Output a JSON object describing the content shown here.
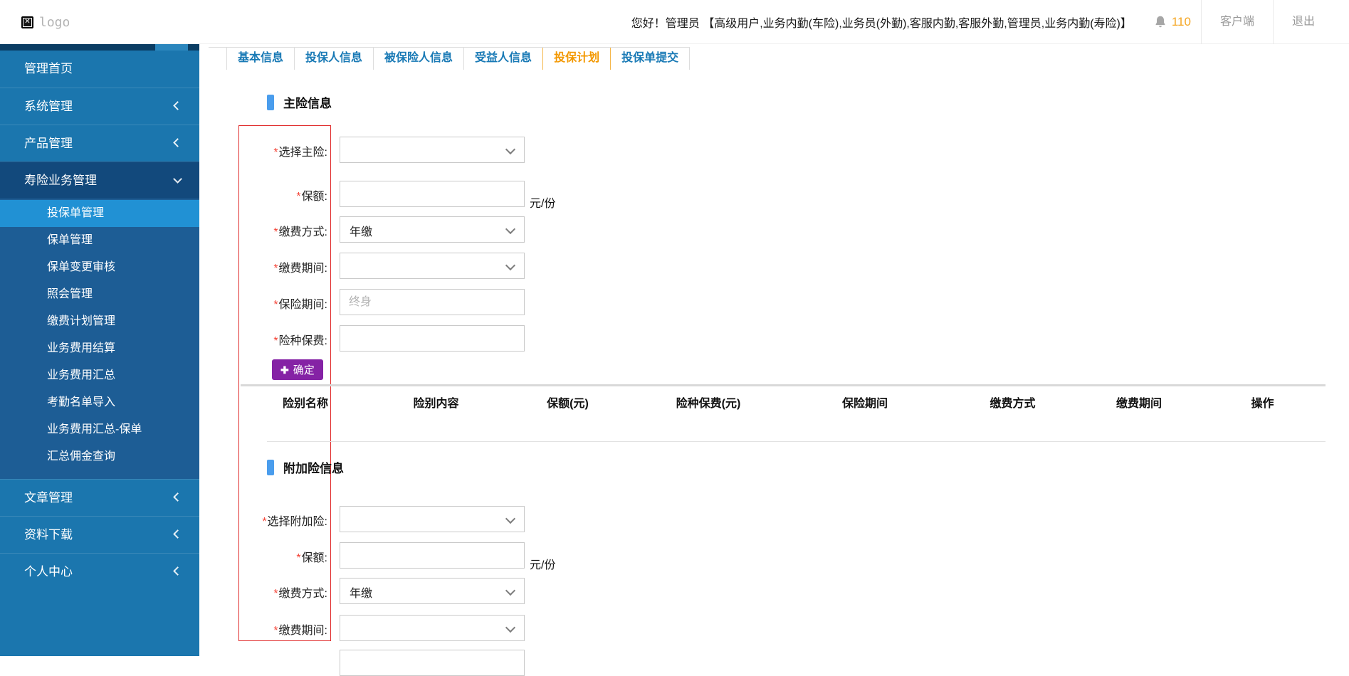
{
  "header": {
    "logo_text": "logo",
    "greeting": "您好！管理员 【高级用户,业务内勤(车险),业务员(外勤),客服内勤,客服外勤,管理员,业务内勤(寿险)】",
    "notification_count": "110",
    "client_label": "客户端",
    "logout_label": "退出"
  },
  "sidebar": {
    "items": [
      {
        "label": "管理首页"
      },
      {
        "label": "系统管理",
        "chevron": "left"
      },
      {
        "label": "产品管理",
        "chevron": "left"
      },
      {
        "label": "寿险业务管理",
        "chevron": "down",
        "expanded": true
      },
      {
        "label": "文章管理",
        "chevron": "left"
      },
      {
        "label": "资料下载",
        "chevron": "left"
      },
      {
        "label": "个人中心",
        "chevron": "left"
      }
    ],
    "submenu": [
      {
        "label": "投保单管理",
        "active": true
      },
      {
        "label": "保单管理"
      },
      {
        "label": "保单变更审核"
      },
      {
        "label": "照会管理"
      },
      {
        "label": "缴费计划管理"
      },
      {
        "label": "业务费用结算"
      },
      {
        "label": "业务费用汇总"
      },
      {
        "label": "考勤名单导入"
      },
      {
        "label": "业务费用汇总-保单"
      },
      {
        "label": "汇总佣金查询"
      }
    ]
  },
  "tabs": [
    {
      "label": "基本信息"
    },
    {
      "label": "投保人信息"
    },
    {
      "label": "被保险人信息"
    },
    {
      "label": "受益人信息"
    },
    {
      "label": "投保计划",
      "active": true
    },
    {
      "label": "投保单提交"
    }
  ],
  "form": {
    "required_mark": "*",
    "main_section": {
      "title": "主险信息",
      "fields": {
        "select_main": {
          "label": "选择主险:",
          "value": ""
        },
        "amount": {
          "label": "保额:",
          "value": "",
          "suffix": "元/份"
        },
        "pay_method": {
          "label": "缴费方式:",
          "value": "年缴"
        },
        "pay_period": {
          "label": "缴费期间:",
          "value": ""
        },
        "insure_period": {
          "label": "保险期间:",
          "value": "",
          "placeholder": "终身"
        },
        "premium": {
          "label": "险种保费:",
          "value": ""
        }
      },
      "confirm_button": "确定"
    },
    "additional_section": {
      "title": "附加险信息",
      "fields": {
        "select_additional": {
          "label": "选择附加险:",
          "value": ""
        },
        "amount": {
          "label": "保额:",
          "value": "",
          "suffix": "元/份"
        },
        "pay_method": {
          "label": "缴费方式:",
          "value": "年缴"
        },
        "pay_period": {
          "label": "缴费期间:",
          "value": ""
        }
      }
    }
  },
  "table": {
    "headers": [
      "险别名称",
      "险别内容",
      "保额(元)",
      "险种保费(元)",
      "保险期间",
      "缴费方式",
      "缴费期间",
      "操作"
    ]
  },
  "icons": {
    "logo": "broken-image",
    "notification": "bell",
    "confirm_plus": "✚",
    "broken_glyph": "✕"
  },
  "colors": {
    "sidebar_bg": "#1b76ae",
    "sidebar_group_bg": "#12497c",
    "submenu_bg": "#1d5d95",
    "submenu_active_bg": "#2191d4",
    "tab_text": "#1879b5",
    "tab_active": "#f39800",
    "accent_bar": "#4a9ded",
    "confirm_purple": "#8522a5",
    "notification_orange": "#f5a623",
    "required_red": "#f44336",
    "highlight_box_red": "#e02b2b"
  }
}
